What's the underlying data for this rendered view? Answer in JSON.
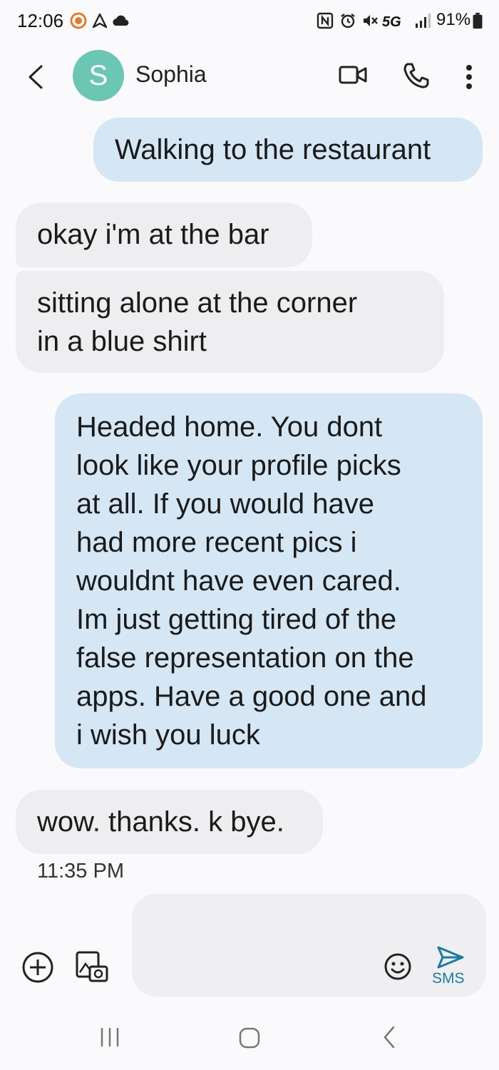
{
  "status_bar": {
    "time": "12:06",
    "network": "5G",
    "battery": "91%"
  },
  "header": {
    "avatar_initial": "S",
    "contact_name": "Sophia",
    "icons": [
      "back-icon",
      "video-call-icon",
      "phone-icon",
      "more-icon"
    ]
  },
  "messages": [
    {
      "direction": "outgoing",
      "text": "Walking to the restaurant"
    },
    {
      "direction": "incoming",
      "text": "okay i'm at the bar"
    },
    {
      "direction": "incoming",
      "text": "sitting alone at the corner\nin a blue shirt"
    },
    {
      "direction": "outgoing",
      "text": "Headed home.  You dont\nlook like your profile picks\nat all.  If you would have\nhad more recent pics i\nwouldnt have even cared.\nIm just getting tired of the\nfalse representation on the\napps.  Have a good one and\ni wish you luck"
    },
    {
      "direction": "incoming",
      "text": "wow. thanks. k bye."
    }
  ],
  "last_timestamp": "11:35 PM",
  "composer": {
    "send_label": "SMS",
    "icons": [
      "add-icon",
      "gallery-icon",
      "emoji-icon",
      "send-icon"
    ]
  },
  "nav_bar": {
    "icons": [
      "recents-icon",
      "home-icon",
      "back-icon"
    ]
  }
}
